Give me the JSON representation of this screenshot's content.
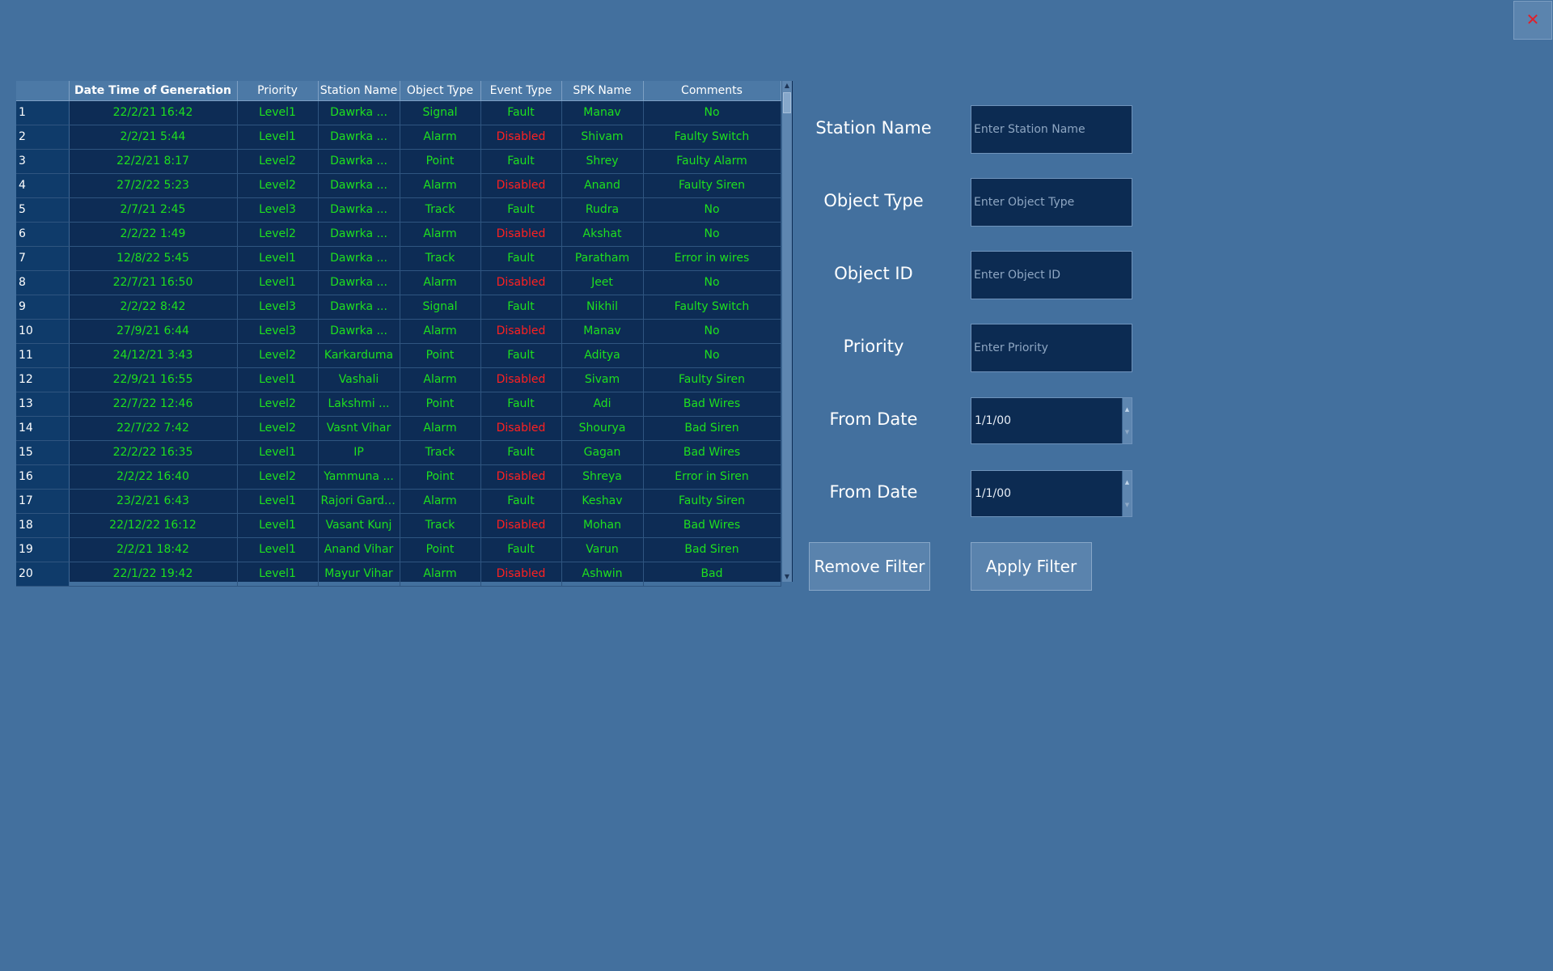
{
  "window": {
    "close_icon": "close-icon",
    "close_glyph": "✕",
    "close_color": "#e0202a"
  },
  "table": {
    "columns": [
      "Date Time of Generation",
      "Priority",
      "Station Name",
      "Object Type",
      "Event Type",
      "SPK Name",
      "Comments"
    ],
    "rows": [
      {
        "n": "1",
        "date": "22/2/21 16:42",
        "priority": "Level1",
        "station": "Dawrka ...",
        "object": "Signal",
        "event": "Fault",
        "spk": "Manav",
        "comment": "No"
      },
      {
        "n": "2",
        "date": "2/2/21 5:44",
        "priority": "Level1",
        "station": "Dawrka ...",
        "object": "Alarm",
        "event": "Disabled",
        "spk": "Shivam",
        "comment": "Faulty Switch"
      },
      {
        "n": "3",
        "date": "22/2/21 8:17",
        "priority": "Level2",
        "station": "Dawrka ...",
        "object": "Point",
        "event": "Fault",
        "spk": "Shrey",
        "comment": "Faulty Alarm"
      },
      {
        "n": "4",
        "date": "27/2/22 5:23",
        "priority": "Level2",
        "station": "Dawrka ...",
        "object": "Alarm",
        "event": "Disabled",
        "spk": "Anand",
        "comment": "Faulty Siren"
      },
      {
        "n": "5",
        "date": "2/7/21 2:45",
        "priority": "Level3",
        "station": "Dawrka ...",
        "object": "Track",
        "event": "Fault",
        "spk": "Rudra",
        "comment": "No"
      },
      {
        "n": "6",
        "date": "2/2/22 1:49",
        "priority": "Level2",
        "station": "Dawrka ...",
        "object": "Alarm",
        "event": "Disabled",
        "spk": "Akshat",
        "comment": "No"
      },
      {
        "n": "7",
        "date": "12/8/22 5:45",
        "priority": "Level1",
        "station": "Dawrka ...",
        "object": "Track",
        "event": "Fault",
        "spk": "Paratham",
        "comment": "Error in wires"
      },
      {
        "n": "8",
        "date": "22/7/21 16:50",
        "priority": "Level1",
        "station": "Dawrka ...",
        "object": "Alarm",
        "event": "Disabled",
        "spk": "Jeet",
        "comment": "No"
      },
      {
        "n": "9",
        "date": "2/2/22 8:42",
        "priority": "Level3",
        "station": "Dawrka ...",
        "object": "Signal",
        "event": "Fault",
        "spk": "Nikhil",
        "comment": "Faulty Switch"
      },
      {
        "n": "10",
        "date": "27/9/21 6:44",
        "priority": "Level3",
        "station": "Dawrka ...",
        "object": "Alarm",
        "event": "Disabled",
        "spk": "Manav",
        "comment": "No"
      },
      {
        "n": "11",
        "date": "24/12/21 3:43",
        "priority": "Level2",
        "station": "Karkarduma",
        "object": "Point",
        "event": "Fault",
        "spk": "Aditya",
        "comment": "No"
      },
      {
        "n": "12",
        "date": "22/9/21 16:55",
        "priority": "Level1",
        "station": "Vashali",
        "object": "Alarm",
        "event": "Disabled",
        "spk": "Sivam",
        "comment": "Faulty Siren"
      },
      {
        "n": "13",
        "date": "22/7/22 12:46",
        "priority": "Level2",
        "station": "Lakshmi ...",
        "object": "Point",
        "event": "Fault",
        "spk": "Adi",
        "comment": "Bad Wires"
      },
      {
        "n": "14",
        "date": "22/7/22 7:42",
        "priority": "Level2",
        "station": "Vasnt Vihar",
        "object": "Alarm",
        "event": "Disabled",
        "spk": "Shourya",
        "comment": "Bad Siren"
      },
      {
        "n": "15",
        "date": "22/2/22 16:35",
        "priority": "Level1",
        "station": "IP",
        "object": "Track",
        "event": "Fault",
        "spk": "Gagan",
        "comment": "Bad Wires"
      },
      {
        "n": "16",
        "date": "2/2/22 16:40",
        "priority": "Level2",
        "station": "Yammuna ...",
        "object": "Point",
        "event": "Disabled",
        "spk": "Shreya",
        "comment": "Error in Siren"
      },
      {
        "n": "17",
        "date": "23/2/21 6:43",
        "priority": "Level1",
        "station": "Rajori Garden",
        "object": "Alarm",
        "event": "Fault",
        "spk": "Keshav",
        "comment": "Faulty Siren"
      },
      {
        "n": "18",
        "date": "22/12/22 16:12",
        "priority": "Level1",
        "station": "Vasant Kunj",
        "object": "Track",
        "event": "Disabled",
        "spk": "Mohan",
        "comment": "Bad Wires"
      },
      {
        "n": "19",
        "date": "2/2/21 18:42",
        "priority": "Level1",
        "station": "Anand Vihar",
        "object": "Point",
        "event": "Fault",
        "spk": "Varun",
        "comment": "Bad Siren"
      },
      {
        "n": "20",
        "date": "22/1/22 19:42",
        "priority": "Level1",
        "station": "Mayur Vihar",
        "object": "Alarm",
        "event": "Disabled",
        "spk": "Ashwin",
        "comment": "Bad"
      }
    ],
    "colors": {
      "normal": "#1ee01e",
      "disabled": "#ff2020"
    }
  },
  "filters": {
    "station_name": {
      "label": "Station Name",
      "placeholder": "Enter Station Name"
    },
    "object_type": {
      "label": "Object Type",
      "placeholder": "Enter Object Type"
    },
    "object_id": {
      "label": "Object ID",
      "placeholder": "Enter Object ID"
    },
    "priority": {
      "label": "Priority",
      "placeholder": "Enter Priority"
    },
    "from_date_1": {
      "label": "From Date",
      "value": "1/1/00"
    },
    "from_date_2": {
      "label": "From Date",
      "value": "1/1/00"
    },
    "remove_button": "Remove Filter",
    "apply_button": "Apply Filter"
  }
}
